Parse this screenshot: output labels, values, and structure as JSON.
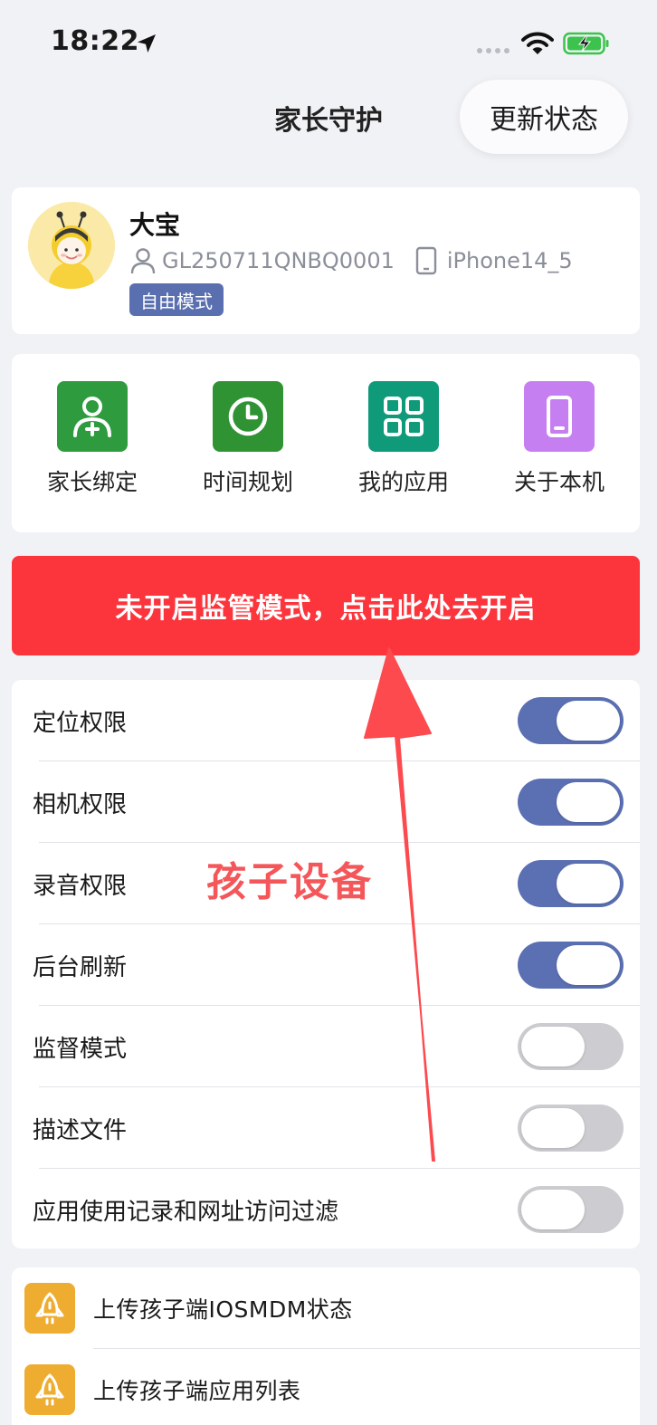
{
  "status_bar": {
    "time": "18:22"
  },
  "nav": {
    "title": "家长守护",
    "update_button": "更新状态"
  },
  "profile": {
    "name": "大宝",
    "device_id": "GL250711QNBQ0001",
    "device_model": "iPhone14_5",
    "mode_badge": "自由模式"
  },
  "quick_actions": [
    {
      "label": "家长绑定",
      "icon": "user-add-icon",
      "color": "#2e9c3e"
    },
    {
      "label": "时间规划",
      "icon": "clock-icon",
      "color": "#2f9334"
    },
    {
      "label": "我的应用",
      "icon": "apps-grid-icon",
      "color": "#0f9a79"
    },
    {
      "label": "关于本机",
      "icon": "phone-icon",
      "color": "#c67ff0"
    }
  ],
  "alert": {
    "text": "未开启监管模式，点击此处去开启"
  },
  "overlay_label": "孩子设备",
  "permissions": [
    {
      "label": "定位权限",
      "enabled": true
    },
    {
      "label": "相机权限",
      "enabled": true
    },
    {
      "label": "录音权限",
      "enabled": true
    },
    {
      "label": "后台刷新",
      "enabled": true
    },
    {
      "label": "监督模式",
      "enabled": false
    },
    {
      "label": "描述文件",
      "enabled": false
    },
    {
      "label": "应用使用记录和网址访问过滤",
      "enabled": false
    }
  ],
  "uploads": [
    {
      "label": "上传孩子端IOSMDM状态",
      "icon": "rocket-icon"
    },
    {
      "label": "上传孩子端应用列表",
      "icon": "rocket-icon"
    }
  ],
  "colors": {
    "accent": "#5b70b3",
    "alert": "#fc353d",
    "toggle_off": "#cdcdd1",
    "upload_icon": "#eead31"
  }
}
